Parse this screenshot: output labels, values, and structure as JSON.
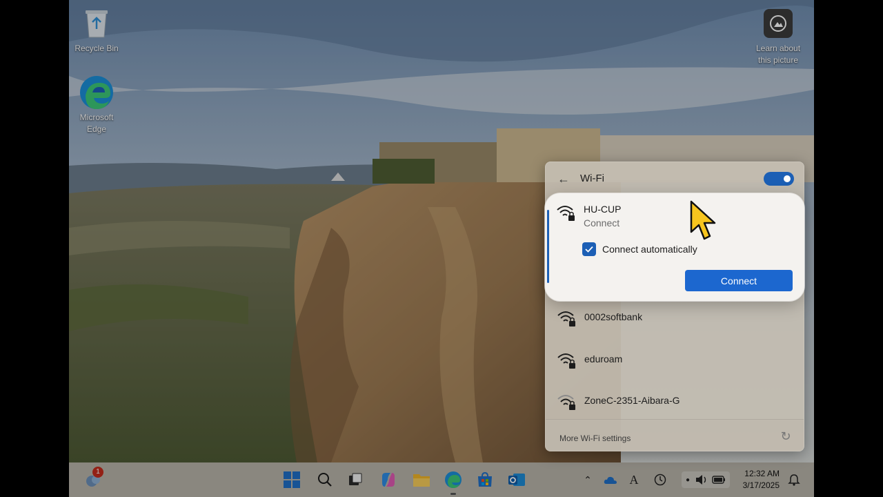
{
  "desktop": {
    "icons": [
      {
        "label": "Recycle Bin",
        "icon": "recycle-bin-icon"
      },
      {
        "label": "Microsoft Edge",
        "icon": "edge-icon"
      },
      {
        "label": "Learn about this picture",
        "icon": "camera-icon"
      }
    ]
  },
  "wifi_flyout": {
    "title": "Wi-Fi",
    "toggle_on": true,
    "selected_network": {
      "name": "HU-CUP",
      "status": "Connect",
      "connect_automatically_label": "Connect automatically",
      "connect_automatically_checked": true,
      "connect_button_label": "Connect"
    },
    "networks": [
      {
        "name": "0002softbank",
        "secured": true
      },
      {
        "name": "eduroam",
        "secured": true
      },
      {
        "name": "ZoneC-2351-Aibara-G",
        "secured": true
      }
    ],
    "footer": {
      "more_settings_label": "More Wi-Fi settings"
    }
  },
  "taskbar": {
    "widget_badge": "1",
    "pinned": [
      "start-icon",
      "search-icon",
      "task-view-icon",
      "copilot-icon",
      "file-explorer-icon",
      "edge-icon",
      "store-icon",
      "outlook-icon"
    ],
    "clock": {
      "time": "12:32 AM",
      "date": "3/17/2025"
    }
  },
  "colors": {
    "accent": "#1c5fb5",
    "button": "#1c67cf"
  }
}
